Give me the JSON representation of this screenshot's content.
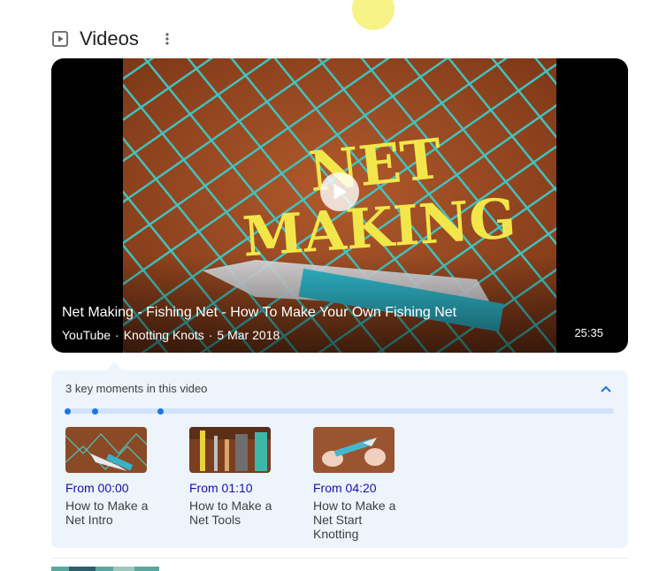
{
  "section": {
    "title": "Videos",
    "icon": "video-play-icon",
    "more_icon": "more-vert-icon"
  },
  "video": {
    "title": "Net Making - Fishing Net - How To Make Your Own Fishing Net",
    "source": "YouTube",
    "channel": "Knotting Knots",
    "date": "5 Mar 2018",
    "duration": "25:35",
    "thumbnail_text_line1": "NET",
    "thumbnail_text_line2": "MAKING",
    "play_icon": "play-icon"
  },
  "key_moments": {
    "heading": "3 key moments in this video",
    "toggle_icon": "chevron-up-icon",
    "items": [
      {
        "time": "From 00:00",
        "label": "How to Make a Net Intro",
        "fraction": 0.0
      },
      {
        "time": "From 01:10",
        "label": "How to Make a Net Tools",
        "fraction": 0.046
      },
      {
        "time": "From 04:20",
        "label": "How to Make a Net Start Knotting",
        "fraction": 0.169
      }
    ]
  },
  "colors": {
    "accent": "#1a73e8",
    "link": "#1a0dab",
    "panel": "#eef4fc",
    "track": "#d2e3fc"
  }
}
